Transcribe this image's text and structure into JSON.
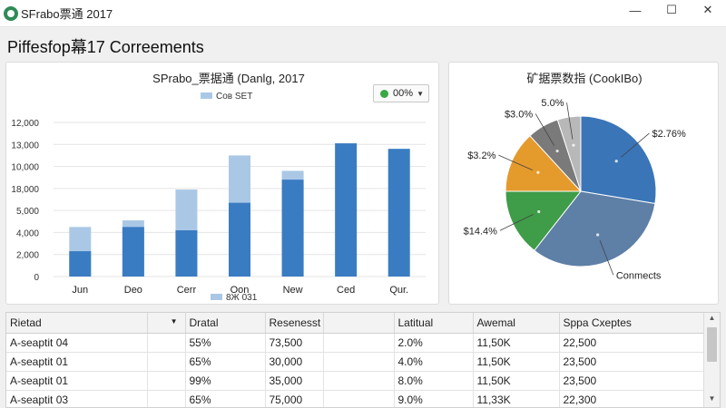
{
  "window": {
    "title": "SFrabo票通 2017",
    "minimize_icon": "minimize-icon",
    "maximize_icon": "maximize-icon",
    "close_icon": "close-icon"
  },
  "page": {
    "heading": "Piffesfop幕17 Correements"
  },
  "bar_dropdown": {
    "value": "00%",
    "dot_color": "#3aa845"
  },
  "chart_data": [
    {
      "type": "bar",
      "title": "SPrabo_票据通 (Danlg, 2017",
      "legend_top": "Coв SET",
      "legend_bottom": "8Ж 031",
      "categories": [
        "Jun",
        "Deo",
        "Cerr",
        "Oon",
        "New",
        "Ced",
        "Qur."
      ],
      "ylim": [
        0,
        14000
      ],
      "ytick_labels": [
        "0",
        "2,000",
        "4,000",
        "5,000",
        "18,000",
        "10,000",
        "13,000",
        "12,000"
      ],
      "series": [
        {
          "name": "Coв SET",
          "color": "#aac8e6",
          "values": [
            4500,
            5100,
            7900,
            11000,
            9600,
            0,
            0
          ]
        },
        {
          "name": "8Ж 031",
          "color": "#3a7cc2",
          "values": [
            2300,
            4500,
            4200,
            6700,
            8800,
            12100,
            11600
          ]
        }
      ],
      "grid": true
    },
    {
      "type": "pie",
      "title": "矿据票数指 (CookIBo)",
      "slices": [
        {
          "label": "$2.76%",
          "value": 27.6,
          "color": "#3a75b8"
        },
        {
          "label": "Conmects",
          "value": 33.0,
          "color": "#5e7fa6"
        },
        {
          "label": "$14.4%",
          "value": 14.4,
          "color": "#3f9c48"
        },
        {
          "label": "$3.2%",
          "value": 13.2,
          "color": "#e59a2c"
        },
        {
          "label": "$3.0%",
          "value": 6.8,
          "color": "#7a7a7a"
        },
        {
          "label": "5.0%",
          "value": 5.0,
          "color": "#b8b8b8"
        }
      ]
    }
  ],
  "table": {
    "headers": [
      "Rietad",
      "",
      "Dratal",
      "Resenesst",
      "",
      "Latitual",
      "Awemal",
      "Sppa Cxeptes"
    ],
    "rows": [
      [
        "A-seaptit 04",
        "",
        "55%",
        "73,500",
        "",
        "2.0%",
        "11,50K",
        "22,500"
      ],
      [
        "A-seaptit 01",
        "",
        "65%",
        "30,000",
        "",
        "4.0%",
        "11,50K",
        "23,500"
      ],
      [
        "A-seaptit 01",
        "",
        "99%",
        "35,000",
        "",
        "8.0%",
        "11,50K",
        "23,500"
      ],
      [
        "A-seaptit 03",
        "",
        "65%",
        "75,000",
        "",
        "9.0%",
        "11,33K",
        "22,300"
      ]
    ]
  }
}
